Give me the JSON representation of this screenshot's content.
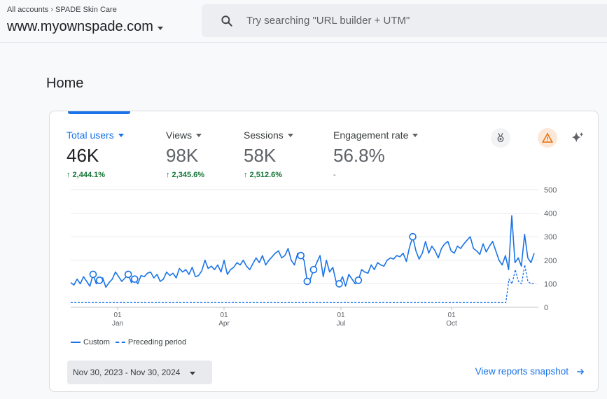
{
  "header": {
    "breadcrumb_all": "All accounts",
    "breadcrumb_sep": "›",
    "breadcrumb_account": "SPADE Skin Care",
    "property": "www.myownspade.com",
    "search_placeholder": "Try searching \"URL builder + UTM\""
  },
  "page": {
    "title": "Home"
  },
  "metrics": [
    {
      "label": "Total users",
      "value": "46K",
      "change": "↑ 2,444.1%"
    },
    {
      "label": "Views",
      "value": "98K",
      "change": "↑ 2,345.6%"
    },
    {
      "label": "Sessions",
      "value": "58K",
      "change": "↑ 2,512.6%"
    },
    {
      "label": "Engagement rate",
      "value": "56.8%",
      "change": "-"
    }
  ],
  "icons": [
    "insights-medal-icon",
    "warning-icon",
    "sparkle-icon",
    "search-icon"
  ],
  "colors": {
    "accent": "#1a73e8",
    "positive": "#137333",
    "warning": "#e8710a"
  },
  "chart_data": {
    "type": "line",
    "x_ticks": [
      {
        "day": "01",
        "month": "Jan"
      },
      {
        "day": "01",
        "month": "Apr"
      },
      {
        "day": "01",
        "month": "Jul"
      },
      {
        "day": "01",
        "month": "Oct"
      }
    ],
    "y_ticks": [
      "500",
      "400",
      "300",
      "200",
      "100",
      "0"
    ],
    "ylim": [
      0,
      500
    ],
    "grid": true,
    "series": [
      {
        "name": "Custom",
        "style": "solid",
        "values": [
          105,
          95,
          120,
          100,
          130,
          110,
          90,
          140,
          100,
          115,
          125,
          85,
          105,
          120,
          150,
          130,
          110,
          125,
          140,
          105,
          120,
          100,
          135,
          130,
          145,
          150,
          125,
          140,
          110,
          120,
          150,
          135,
          145,
          125,
          165,
          150,
          160,
          140,
          170,
          130,
          135,
          155,
          200,
          165,
          175,
          160,
          180,
          150,
          200,
          140,
          160,
          170,
          190,
          180,
          200,
          175,
          160,
          185,
          210,
          190,
          220,
          180,
          200,
          215,
          230,
          240,
          210,
          220,
          250,
          200,
          180,
          230,
          220,
          200,
          110,
          120,
          160,
          190,
          220,
          130,
          200,
          150,
          170,
          110,
          100,
          130,
          90,
          140,
          120,
          100,
          115,
          160,
          150,
          145,
          180,
          160,
          190,
          180,
          175,
          200,
          210,
          205,
          220,
          215,
          230,
          195,
          255,
          300,
          240,
          205,
          230,
          280,
          230,
          260,
          240,
          210,
          250,
          270,
          280,
          240,
          230,
          260,
          250,
          270,
          285,
          300,
          250,
          240,
          225,
          270,
          235,
          260,
          280,
          240,
          200,
          180,
          220,
          160,
          390,
          190,
          210,
          175,
          310,
          210,
          190,
          230
        ]
      },
      {
        "name": "Preceding period",
        "style": "dashed",
        "values": [
          20,
          20,
          20,
          20,
          20,
          20,
          20,
          20,
          20,
          20,
          20,
          20,
          20,
          20,
          20,
          20,
          20,
          20,
          20,
          20,
          20,
          20,
          20,
          20,
          20,
          20,
          20,
          20,
          20,
          20,
          20,
          20,
          20,
          20,
          20,
          20,
          20,
          20,
          20,
          20,
          20,
          20,
          20,
          20,
          20,
          20,
          20,
          20,
          20,
          20,
          20,
          20,
          20,
          20,
          20,
          20,
          20,
          20,
          20,
          20,
          20,
          20,
          20,
          20,
          20,
          20,
          20,
          20,
          20,
          20,
          20,
          20,
          20,
          20,
          20,
          20,
          20,
          20,
          20,
          20,
          20,
          20,
          20,
          20,
          20,
          20,
          20,
          20,
          20,
          20,
          20,
          20,
          20,
          20,
          20,
          20,
          20,
          20,
          20,
          20,
          20,
          20,
          20,
          20,
          20,
          20,
          20,
          20,
          20,
          20,
          20,
          20,
          20,
          20,
          20,
          20,
          20,
          20,
          20,
          20,
          20,
          20,
          20,
          20,
          20,
          20,
          20,
          20,
          20,
          20,
          20,
          20,
          20,
          20,
          20,
          20,
          20,
          20,
          20,
          120,
          100,
          160,
          110,
          100,
          180,
          110,
          100,
          100
        ]
      }
    ]
  },
  "legend": {
    "custom": "Custom",
    "preceding": "Preceding period"
  },
  "footer": {
    "date_range": "Nov 30, 2023 - Nov 30, 2024",
    "snapshot_link": "View reports snapshot"
  }
}
